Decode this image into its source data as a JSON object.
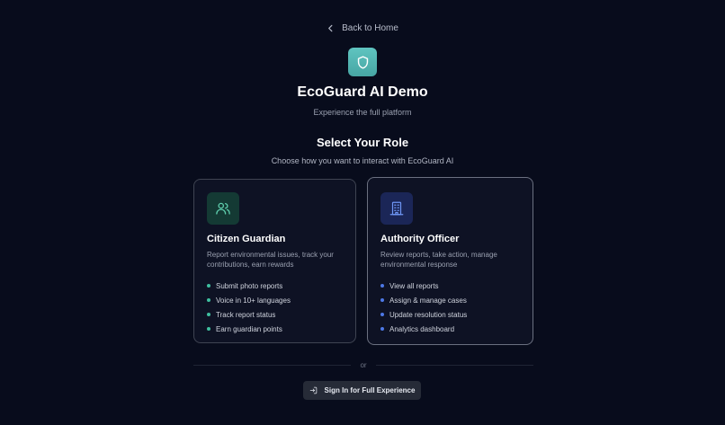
{
  "nav": {
    "back_label": "Back to Home"
  },
  "header": {
    "title": "EcoGuard AI Demo",
    "subtitle": "Experience the full platform"
  },
  "roles_section": {
    "title": "Select Your Role",
    "subtitle": "Choose how you want to interact with EcoGuard AI"
  },
  "roles": [
    {
      "title": "Citizen Guardian",
      "description": "Report environmental issues, track your contributions, earn rewards",
      "icon": "users-icon",
      "accent": "#3fbf9f",
      "features": [
        "Submit photo reports",
        "Voice in 10+ languages",
        "Track report status",
        "Earn guardian points"
      ]
    },
    {
      "title": "Authority Officer",
      "description": "Review reports, take action, manage environmental response",
      "icon": "building-icon",
      "accent": "#4d78e6",
      "features": [
        "View all reports",
        "Assign & manage cases",
        "Update resolution status",
        "Analytics dashboard"
      ]
    }
  ],
  "divider": {
    "label": "or"
  },
  "signin": {
    "label": "Sign In for Full Experience"
  },
  "colors": {
    "background": "#080c1c",
    "logo": "#52b7b4",
    "citizen_accent": "#3fbf9f",
    "authority_accent": "#4d78e6"
  }
}
